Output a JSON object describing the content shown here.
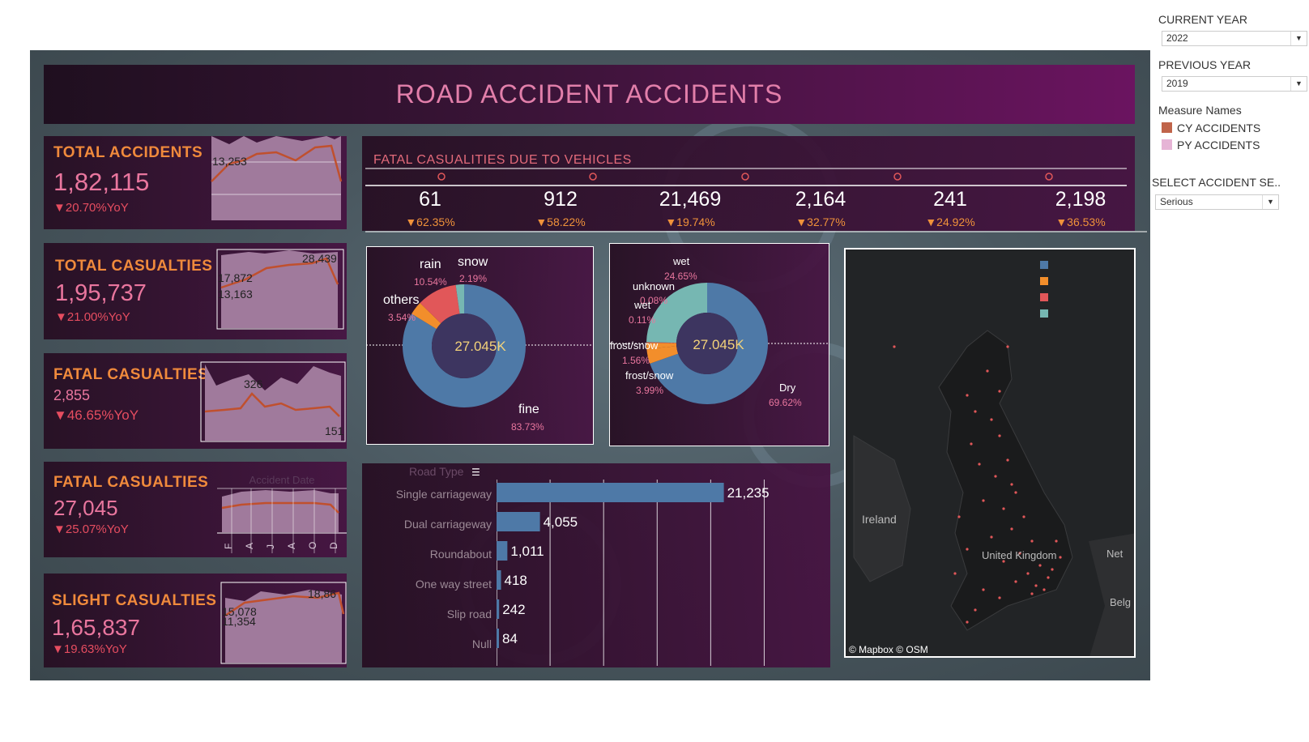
{
  "title": "ROAD ACCIDENT ACCIDENTS",
  "kpis": [
    {
      "label": "TOTAL ACCIDENTS",
      "value": "1,82,115",
      "yoy": "▼20.70%YoY",
      "spark_labels": [
        "13,253"
      ]
    },
    {
      "label": "TOTAL CASUALTIES",
      "value": "1,95,737",
      "yoy": "▼21.00%YoY",
      "spark_labels": [
        "17,872",
        "13,163",
        "28,439"
      ]
    },
    {
      "label": "FATAL CASUALTIES",
      "value": "2,855",
      "yoy": "▼46.65%YoY",
      "spark_labels": [
        "326",
        "151"
      ]
    },
    {
      "label": "FATAL CASUALTIES",
      "value": "27,045",
      "yoy": "▼25.07%YoY",
      "spark_labels": [
        "Accident Date"
      ],
      "months": [
        "F",
        "A",
        "J",
        "A",
        "O",
        "D"
      ]
    },
    {
      "label": "SLIGHT CASUALTIES",
      "value": "1,65,837",
      "yoy": "▼19.63%YoY",
      "spark_labels": [
        "15,078",
        "11,354",
        "18,86"
      ]
    }
  ],
  "vehicles": {
    "title": "FATAL CASUALITIES DUE TO VEHICLES",
    "items": [
      {
        "value": "61",
        "yoy": "▼62.35%"
      },
      {
        "value": "912",
        "yoy": "▼58.22%"
      },
      {
        "value": "21,469",
        "yoy": "▼19.74%"
      },
      {
        "value": "2,164",
        "yoy": "▼32.77%"
      },
      {
        "value": "241",
        "yoy": "▼24.92%"
      },
      {
        "value": "2,198",
        "yoy": "▼36.53%"
      }
    ]
  },
  "weather_donut": {
    "center": "27.045K",
    "slices": [
      {
        "label": "fine",
        "pct": "83.73%",
        "value": 83.73,
        "color": "#4e79a7"
      },
      {
        "label": "others",
        "pct": "3.54%",
        "value": 3.54,
        "color": "#f28e2b"
      },
      {
        "label": "rain",
        "pct": "10.54%",
        "value": 10.54,
        "color": "#e15759"
      },
      {
        "label": "snow",
        "pct": "2.19%",
        "value": 2.19,
        "color": "#76b7b2"
      }
    ]
  },
  "surface_donut": {
    "center": "27.045K",
    "slices": [
      {
        "label": "Dry",
        "pct": "69.62%",
        "value": 69.62,
        "color": "#4e79a7"
      },
      {
        "label": "frost/snow",
        "pct": "3.99%",
        "value": 3.99,
        "color": "#f28e2b"
      },
      {
        "label": "frost/snow",
        "pct": "1.56%",
        "value": 1.56,
        "color": "#f28e2b"
      },
      {
        "label": "wet",
        "pct": "0.11%",
        "value": 0.11,
        "color": "#e15759"
      },
      {
        "label": "unknown",
        "pct": "0.08%",
        "value": 0.08,
        "color": "#e15759"
      },
      {
        "label": "wet",
        "pct": "24.65%",
        "value": 24.65,
        "color": "#76b7b2"
      }
    ]
  },
  "chart_data": {
    "type": "bar",
    "title": "Road Type",
    "categories": [
      "Single carriageway",
      "Dual carriageway",
      "Roundabout",
      "One way street",
      "Slip road",
      "Null"
    ],
    "values": [
      21235,
      4055,
      1011,
      418,
      242,
      84
    ],
    "labels": [
      "21,235",
      "4,055",
      "1,011",
      "418",
      "242",
      "84"
    ],
    "color": "#4e79a7"
  },
  "map": {
    "attribution": "© Mapbox © OSM",
    "labels": [
      "Ireland",
      "United Kingdom",
      "Net",
      "Belg"
    ],
    "legend_colors": [
      "#4e79a7",
      "#f28e2b",
      "#e15759",
      "#76b7b2"
    ]
  },
  "controls": {
    "current_year_label": "CURRENT YEAR",
    "current_year": "2022",
    "previous_year_label": "PREVIOUS YEAR",
    "previous_year": "2019",
    "measure_names_label": "Measure Names",
    "measures": [
      {
        "label": "CY ACCIDENTS",
        "color": "#c0644a"
      },
      {
        "label": "PY ACCIDENTS",
        "color": "#e6b4d6"
      }
    ],
    "severity_label": "SELECT ACCIDENT SE..",
    "severity": "Serious"
  }
}
